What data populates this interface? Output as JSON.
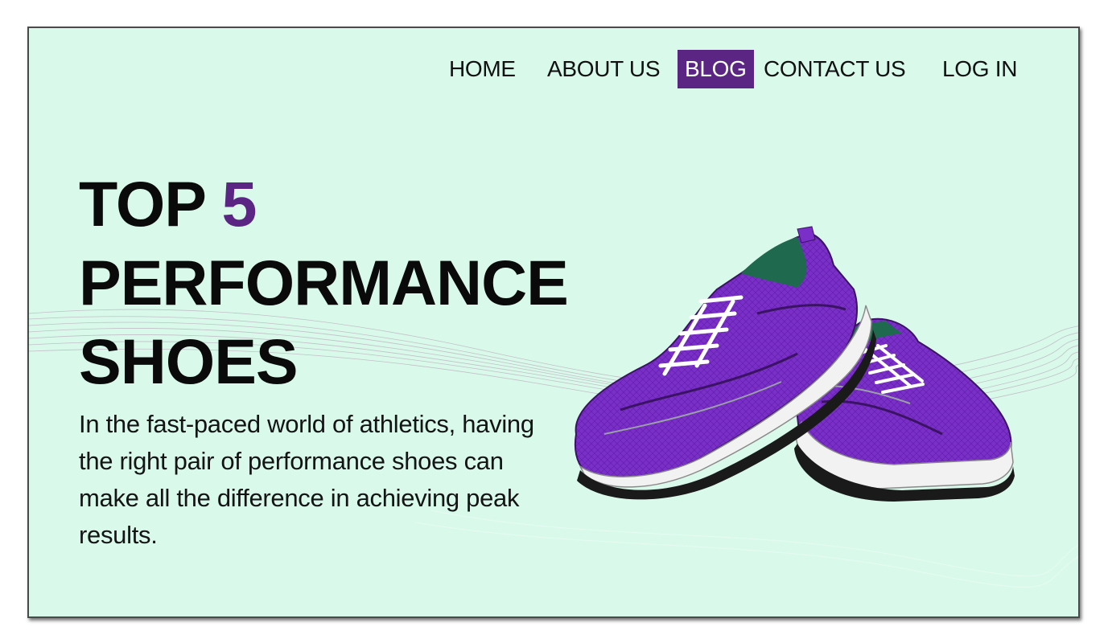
{
  "nav": {
    "items": [
      {
        "label": "HOME",
        "active": false
      },
      {
        "label": "ABOUT US",
        "active": false
      },
      {
        "label": "BLOG",
        "active": true
      },
      {
        "label": "CONTACT US",
        "active": false
      },
      {
        "label": "LOG IN",
        "active": false
      }
    ]
  },
  "hero": {
    "headline_line1_prefix": "TOP ",
    "headline_line1_accent": "5",
    "headline_line2": "PERFORMANCE",
    "headline_line3": "SHOES",
    "body": "In the fast-paced world of athletics, having the right pair of performance shoes can make all the difference in achieving peak results."
  },
  "colors": {
    "background": "#d9f9eb",
    "accent": "#5b2584",
    "text": "#0a0a0a",
    "shoe_purple": "#7b2fc9",
    "shoe_green": "#1f6a4f"
  },
  "icons": {
    "hero_image": "purple-running-shoes-illustration"
  }
}
